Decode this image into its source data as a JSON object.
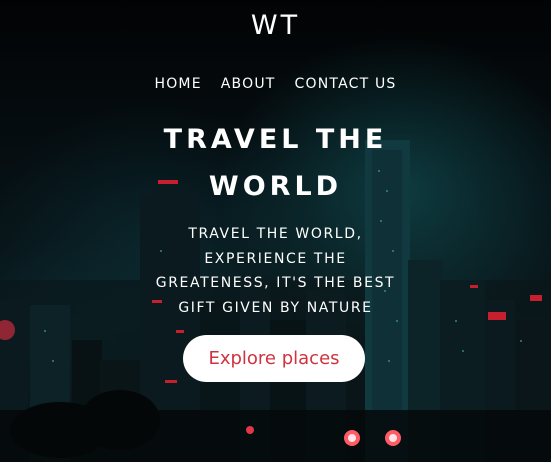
{
  "brand": {
    "logo": "WT"
  },
  "nav": {
    "items": [
      {
        "label": "HOME"
      },
      {
        "label": "ABOUT"
      },
      {
        "label": "CONTACT US"
      }
    ]
  },
  "hero": {
    "headline_lines": [
      "TRAVEL THE",
      "WORLD"
    ],
    "tagline_lines": [
      "TRAVEL THE WORLD,",
      "EXPERIENCE THE",
      "GREATENESS, IT'S THE BEST",
      "GIFT GIVEN BY NATURE"
    ],
    "cta_label": "Explore places",
    "background": "night-city-skyline-photo"
  },
  "colors": {
    "text": "#ffffff",
    "cta_bg": "#ffffff",
    "cta_text": "#d0323e",
    "bg_dark": "#050708",
    "teal_glow": "#1d5f66"
  }
}
